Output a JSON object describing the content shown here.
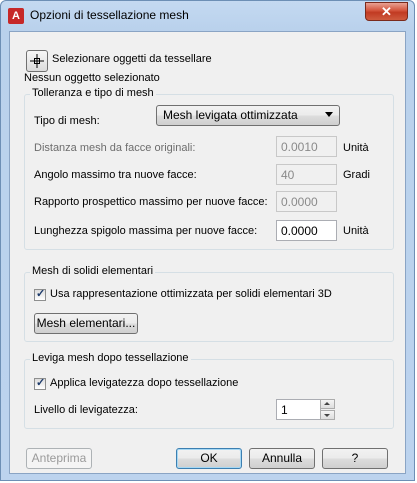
{
  "window": {
    "title": "Opzioni di tessellazione mesh",
    "close_label": "✕",
    "app_icon_letter": "A"
  },
  "select_objects": {
    "button_label": "Selezionare oggetti da tessellare",
    "status": "Nessun oggetto selezionato"
  },
  "tolerance": {
    "group_title": "Tolleranza e tipo di mesh",
    "mesh_type_label": "Tipo di mesh:",
    "mesh_type_value": "Mesh levigata ottimizzata",
    "distance_label": "Distanza mesh da facce originali:",
    "distance_value": "0.0010",
    "distance_unit": "Unità",
    "angle_label": "Angolo massimo tra nuove facce:",
    "angle_value": "40",
    "angle_unit": "Gradi",
    "ratio_label": "Rapporto prospettico massimo per nuove facce:",
    "ratio_value": "0.0000",
    "edge_label": "Lunghezza spigolo massima per nuove facce:",
    "edge_value": "0.0000",
    "edge_unit": "Unità"
  },
  "primitives": {
    "group_title": "Mesh di solidi elementari",
    "checkbox_label": "Usa rappresentazione ottimizzata per solidi elementari 3D",
    "checked": true,
    "button_label": "Mesh elementari..."
  },
  "smooth": {
    "group_title": "Leviga mesh dopo tessellazione",
    "checkbox_label": "Applica levigatezza dopo tessellazione",
    "checked": true,
    "level_label": "Livello di levigatezza:",
    "level_value": "1"
  },
  "footer": {
    "preview_label": "Anteprima",
    "ok_label": "OK",
    "cancel_label": "Annulla",
    "help_label": "?"
  }
}
